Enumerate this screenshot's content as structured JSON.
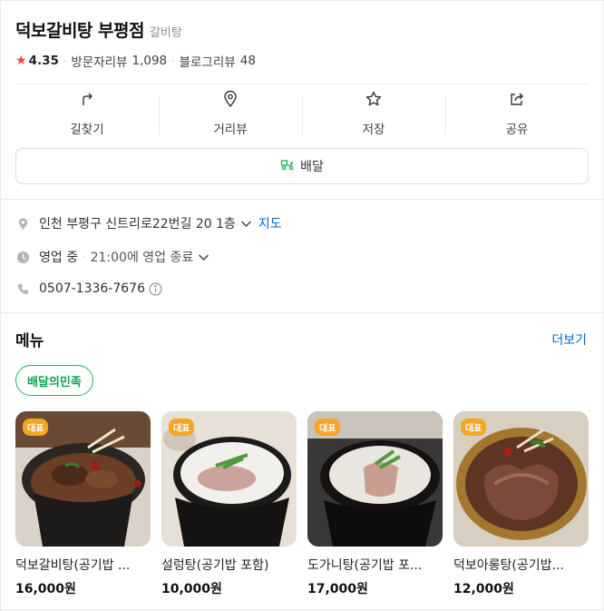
{
  "place": {
    "name": "덕보갈비탕 부평점",
    "category": "갈비탕",
    "rating": "4.35",
    "visitor_review_label": "방문자리뷰",
    "visitor_review_count": "1,098",
    "blog_review_label": "블로그리뷰",
    "blog_review_count": "48"
  },
  "actions": [
    {
      "label": "길찾기",
      "icon": "directions-icon"
    },
    {
      "label": "거리뷰",
      "icon": "street-view-icon"
    },
    {
      "label": "저장",
      "icon": "star-icon"
    },
    {
      "label": "공유",
      "icon": "share-icon"
    }
  ],
  "delivery_button": {
    "label": "배달",
    "icon": "scooter-icon",
    "color": "#19b35f"
  },
  "info": {
    "address": "인천 부평구 신트리로22번길 20 1층",
    "map_link": "지도",
    "status": "영업 중",
    "hours": "21:00에 영업 종료",
    "phone": "0507-1336-7676"
  },
  "menu": {
    "title": "메뉴",
    "more_link": "더보기",
    "chip": "배달의민족",
    "badge": "대표",
    "items": [
      {
        "name": "덕보갈비탕(공기밥 ...",
        "price": "16,000원"
      },
      {
        "name": "설렁탕(공기밥 포함)",
        "price": "10,000원"
      },
      {
        "name": "도가니탕(공기밥 포...",
        "price": "17,000원"
      },
      {
        "name": "덕보아롱탕(공기밥...",
        "price": "12,000원"
      }
    ]
  },
  "colors": {
    "link": "#0068c3",
    "accent_green": "#19b35f",
    "star": "#e94545",
    "badge": "#f5a623"
  }
}
